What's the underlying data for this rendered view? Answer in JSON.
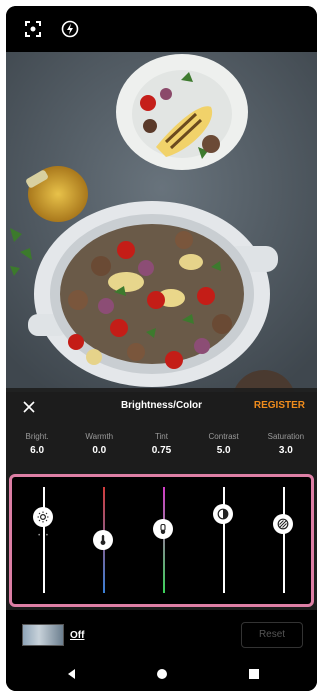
{
  "topbar": {
    "icons": [
      "focus-icon",
      "flash-auto-icon"
    ]
  },
  "panel": {
    "title": "Brightness/Color",
    "register_label": "REGISTER",
    "params": [
      {
        "name": "Bright.",
        "value": "6.0"
      },
      {
        "name": "Warmth",
        "value": "0.0"
      },
      {
        "name": "Tint",
        "value": "0.75"
      },
      {
        "name": "Contrast",
        "value": "5.0"
      },
      {
        "name": "Saturation",
        "value": "3.0"
      }
    ]
  },
  "sliders": [
    {
      "name": "brightness",
      "level": 0.72,
      "color_top": "#ffffff",
      "color_bottom": "#ffffff"
    },
    {
      "name": "warmth",
      "level": 0.5,
      "color_top": "#d23c3c",
      "color_bottom": "#3a7fd6"
    },
    {
      "name": "tint",
      "level": 0.6,
      "color_top": "#d23cc8",
      "color_bottom": "#3cd25a"
    },
    {
      "name": "contrast",
      "level": 0.75,
      "color_top": "#ffffff",
      "color_bottom": "#ffffff"
    },
    {
      "name": "saturation",
      "level": 0.65,
      "color_top": "#ffffff",
      "color_bottom": "#ffffff"
    }
  ],
  "bottom": {
    "off_label": "Off",
    "reset_label": "Reset"
  },
  "colors": {
    "accent": "#f08c1c",
    "highlight_border": "#dd7fa5"
  }
}
